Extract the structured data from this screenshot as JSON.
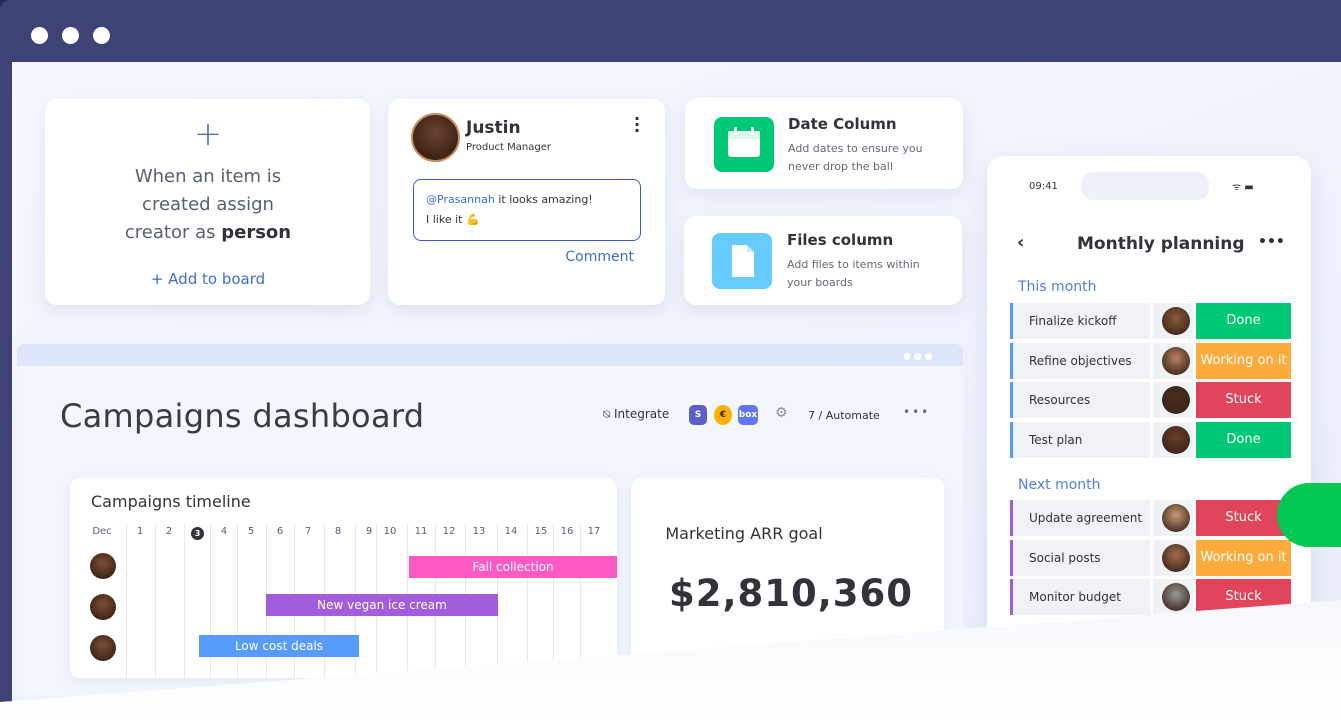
{
  "window": {
    "controls": [
      "close",
      "minimize",
      "maximize"
    ]
  },
  "automation_card": {
    "icon": "plus-icon",
    "text_1": "When an item is",
    "text_2": "created assign",
    "text_3": "creator as",
    "text_bold": "person",
    "action": "+ Add to board"
  },
  "comment_card": {
    "name": "Justin",
    "role": "Product Manager",
    "mention": "@Prasannah",
    "message": " it looks amazing!",
    "message_2": "I like it 💪",
    "action": "Comment"
  },
  "date_column": {
    "title": "Date Column",
    "desc_1": "Add dates to ensure you",
    "desc_2": "never drop the ball",
    "icon": "calendar-icon",
    "color": "#00c875"
  },
  "files_column": {
    "title": "Files column",
    "desc_1": "Add files to items within",
    "desc_2": "your boards",
    "icon": "file-icon",
    "color": "#66ccff"
  },
  "dashboard": {
    "title": "Campaigns dashboard",
    "integrate_label": "Integrate",
    "integrations": [
      "S",
      "€",
      "box"
    ],
    "automate_label": "7 / Automate",
    "more": "•••"
  },
  "timeline": {
    "title": "Campaigns timeline",
    "days": [
      "Dec",
      "1",
      "2",
      "3",
      "4",
      "5",
      "6",
      "7",
      "8",
      "9",
      "10",
      "11",
      "12",
      "13",
      "14",
      "15",
      "16",
      "17"
    ],
    "today": "3",
    "bars": [
      {
        "label": "Fall collection",
        "color": "#ff5ac4"
      },
      {
        "label": "New vegan ice cream",
        "color": "#a25ddc"
      },
      {
        "label": "Low cost deals",
        "color": "#579bfc"
      }
    ]
  },
  "marketing": {
    "label": "Marketing ARR goal",
    "value": "$2,810,360"
  },
  "phone": {
    "time": "09:41",
    "status": "ᯤ ▬",
    "title": "Monthly planning",
    "back": "‹",
    "more": "•••",
    "groups": [
      {
        "name": "This month",
        "color": "#579bfc",
        "items": [
          {
            "name": "Finalize kickoff",
            "status": "Done"
          },
          {
            "name": "Refine objectives",
            "status": "Working on it"
          },
          {
            "name": "Resources",
            "status": "Stuck"
          },
          {
            "name": "Test plan",
            "status": "Done"
          }
        ]
      },
      {
        "name": "Next month",
        "color": "#a25ddc",
        "items": [
          {
            "name": "Update agreement",
            "status": "Stuck"
          },
          {
            "name": "Social posts",
            "status": "Working on it"
          },
          {
            "name": "Monitor budget",
            "status": "Stuck"
          }
        ]
      }
    ],
    "status_colors": {
      "Done": "#00c875",
      "Working on it": "#fdab3d",
      "Stuck": "#e2445c"
    }
  }
}
